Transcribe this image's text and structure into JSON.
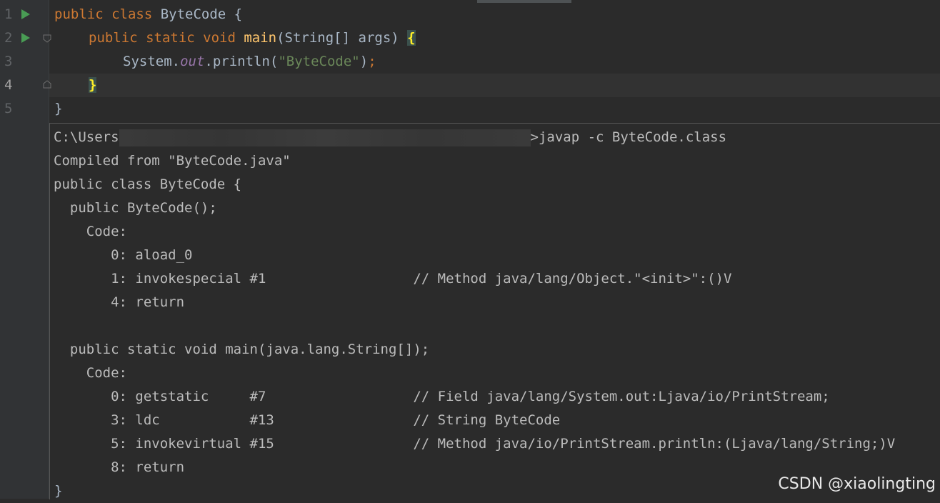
{
  "editor": {
    "lines": [
      {
        "num": "1",
        "has_run": true
      },
      {
        "num": "2",
        "has_run": true
      },
      {
        "num": "3",
        "has_run": false
      },
      {
        "num": "4",
        "has_run": false
      },
      {
        "num": "5",
        "has_run": false
      }
    ],
    "code": {
      "l1_kw": "public class ",
      "l1_rest": "ByteCode {",
      "l2_kw": "public static void ",
      "l2_fn": "main",
      "l2_rest": "(String[] args) ",
      "l2_brace": "{",
      "l3_a": "System.",
      "l3_out": "out",
      "l3_b": ".println(",
      "l3_str": "\"ByteCode\"",
      "l3_c": ")",
      "l3_semi": ";",
      "l4_brace": "}",
      "l5": "}"
    }
  },
  "terminal": {
    "prompt_prefix": "C:\\Users",
    "command": ">javap -c ByteCode.class",
    "lines": [
      "Compiled from \"ByteCode.java\"",
      "public class ByteCode {",
      "  public ByteCode();",
      "    Code:",
      "       0: aload_0",
      "       1: invokespecial #1                  // Method java/lang/Object.\"<init>\":()V",
      "       4: return",
      "",
      "  public static void main(java.lang.String[]);",
      "    Code:",
      "       0: getstatic     #7                  // Field java/lang/System.out:Ljava/io/PrintStream;",
      "       3: ldc           #13                 // String ByteCode",
      "       5: invokevirtual #15                 // Method java/io/PrintStream.println:(Ljava/lang/String;)V",
      "       8: return"
    ],
    "closing": "}"
  },
  "watermark": "CSDN @xiaolingting"
}
